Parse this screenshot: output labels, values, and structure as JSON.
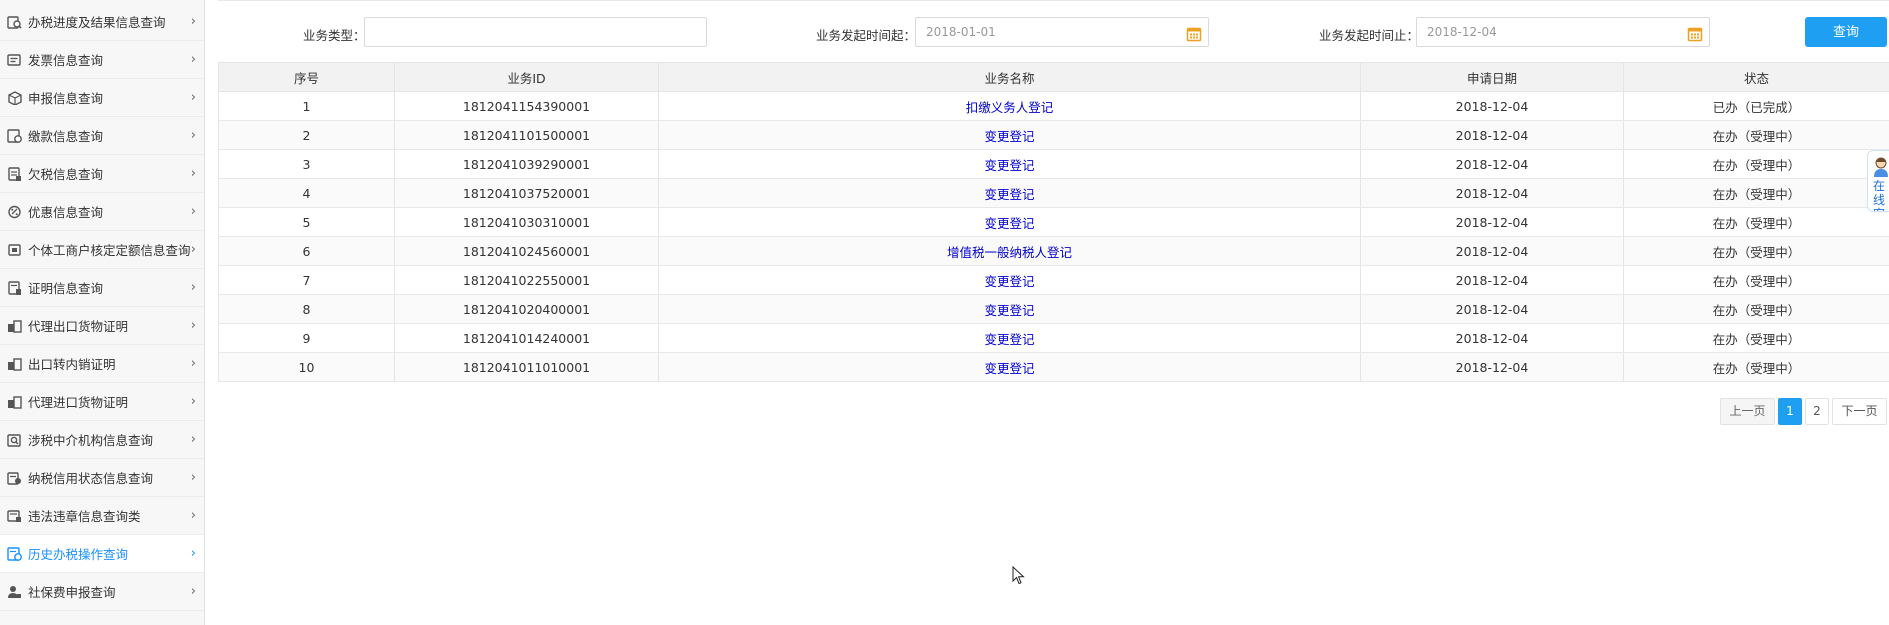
{
  "sidebar": {
    "items": [
      {
        "label": "办税进度及结果信息查询",
        "icon": "progress-search-icon"
      },
      {
        "label": "发票信息查询",
        "icon": "invoice-icon"
      },
      {
        "label": "申报信息查询",
        "icon": "declare-box-icon"
      },
      {
        "label": "缴款信息查询",
        "icon": "payment-icon"
      },
      {
        "label": "欠税信息查询",
        "icon": "arrears-icon"
      },
      {
        "label": "优惠信息查询",
        "icon": "discount-icon"
      },
      {
        "label": "个体工商户核定定额信息查询",
        "icon": "business-icon"
      },
      {
        "label": "证明信息查询",
        "icon": "certificate-icon"
      },
      {
        "label": "代理出口货物证明",
        "icon": "export-proxy-icon"
      },
      {
        "label": "出口转内销证明",
        "icon": "domestic-sale-icon"
      },
      {
        "label": "代理进口货物证明",
        "icon": "import-proxy-icon"
      },
      {
        "label": "涉税中介机构信息查询",
        "icon": "agency-icon"
      },
      {
        "label": "纳税信用状态信息查询",
        "icon": "credit-icon"
      },
      {
        "label": "违法违章信息查询类",
        "icon": "violation-icon"
      },
      {
        "label": "历史办税操作查询",
        "icon": "history-icon",
        "active": true
      },
      {
        "label": "社保费申报查询",
        "icon": "social-security-icon"
      }
    ],
    "active_color": "#1890ff"
  },
  "filter": {
    "type_label": "业务类型：",
    "type_value": "",
    "start_label": "业务发起时间起：",
    "start_value": "2018-01-01",
    "end_label": "业务发起时间止：",
    "end_value": "2018-12-04",
    "query_button": "查询",
    "accent": "#1e9ff2",
    "calendar_icon_color": "#f0a020"
  },
  "table": {
    "headers": [
      "序号",
      "业务ID",
      "业务名称",
      "申请日期",
      "状态"
    ],
    "rows": [
      [
        "1",
        "1812041154390001",
        "扣缴义务人登记",
        "2018-12-04",
        "已办（已完成）"
      ],
      [
        "2",
        "1812041101500001",
        "变更登记",
        "2018-12-04",
        "在办（受理中）"
      ],
      [
        "3",
        "1812041039290001",
        "变更登记",
        "2018-12-04",
        "在办（受理中）"
      ],
      [
        "4",
        "1812041037520001",
        "变更登记",
        "2018-12-04",
        "在办（受理中）"
      ],
      [
        "5",
        "1812041030310001",
        "变更登记",
        "2018-12-04",
        "在办（受理中）"
      ],
      [
        "6",
        "1812041024560001",
        "增值税一般纳税人登记",
        "2018-12-04",
        "在办（受理中）"
      ],
      [
        "7",
        "1812041022550001",
        "变更登记",
        "2018-12-04",
        "在办（受理中）"
      ],
      [
        "8",
        "1812041020400001",
        "变更登记",
        "2018-12-04",
        "在办（受理中）"
      ],
      [
        "9",
        "1812041014240001",
        "变更登记",
        "2018-12-04",
        "在办（受理中）"
      ],
      [
        "10",
        "1812041011010001",
        "变更登记",
        "2018-12-04",
        "在办（受理中）"
      ]
    ],
    "link_color": "#0000cc"
  },
  "pagination": {
    "prev": "上一页",
    "pages": [
      "1",
      "2"
    ],
    "current": "1",
    "next": "下一页"
  },
  "help_widget": {
    "text": "在线客服",
    "icon": "customer-service-avatar-icon"
  }
}
